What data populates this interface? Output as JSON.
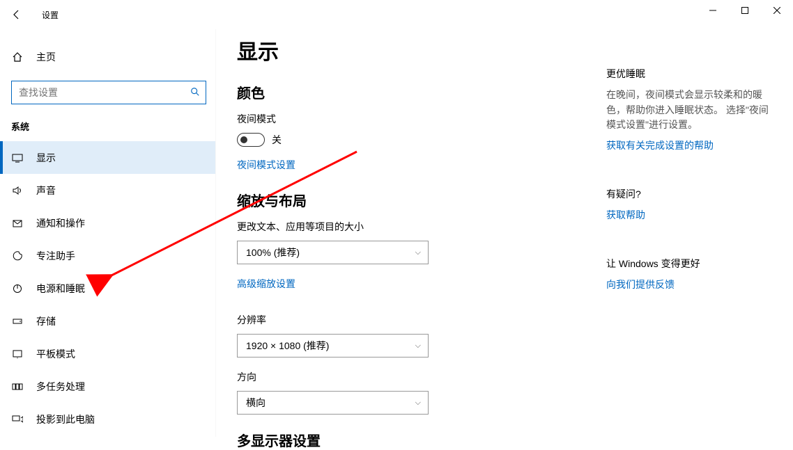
{
  "titlebar": {
    "title": "设置"
  },
  "sidebar": {
    "home_label": "主页",
    "search_placeholder": "查找设置",
    "category_label": "系统",
    "items": [
      {
        "icon": "display",
        "label": "显示"
      },
      {
        "icon": "sound",
        "label": "声音"
      },
      {
        "icon": "notify",
        "label": "通知和操作"
      },
      {
        "icon": "focus",
        "label": "专注助手"
      },
      {
        "icon": "power",
        "label": "电源和睡眠"
      },
      {
        "icon": "storage",
        "label": "存储"
      },
      {
        "icon": "tablet",
        "label": "平板模式"
      },
      {
        "icon": "multitask",
        "label": "多任务处理"
      },
      {
        "icon": "project",
        "label": "投影到此电脑"
      }
    ]
  },
  "main": {
    "page_title": "显示",
    "color_section": "颜色",
    "night_mode_label": "夜间模式",
    "night_mode_state": "关",
    "night_mode_settings_link": "夜间模式设置",
    "scale_section": "缩放与布局",
    "scale_label": "更改文本、应用等项目的大小",
    "scale_value": "100% (推荐)",
    "advanced_scale_link": "高级缩放设置",
    "resolution_label": "分辨率",
    "resolution_value": "1920 × 1080 (推荐)",
    "orientation_label": "方向",
    "orientation_value": "横向",
    "multi_display_section": "多显示器设置"
  },
  "aside": {
    "sleep_h": "更优睡眠",
    "sleep_text": "在晚间，夜间模式会显示较柔和的暖色，帮助你进入睡眠状态。 选择\"夜间模式设置\"进行设置。",
    "sleep_link": "获取有关完成设置的帮助",
    "question_h": "有疑问?",
    "question_link": "获取帮助",
    "feedback_h": "让 Windows 变得更好",
    "feedback_link": "向我们提供反馈"
  }
}
